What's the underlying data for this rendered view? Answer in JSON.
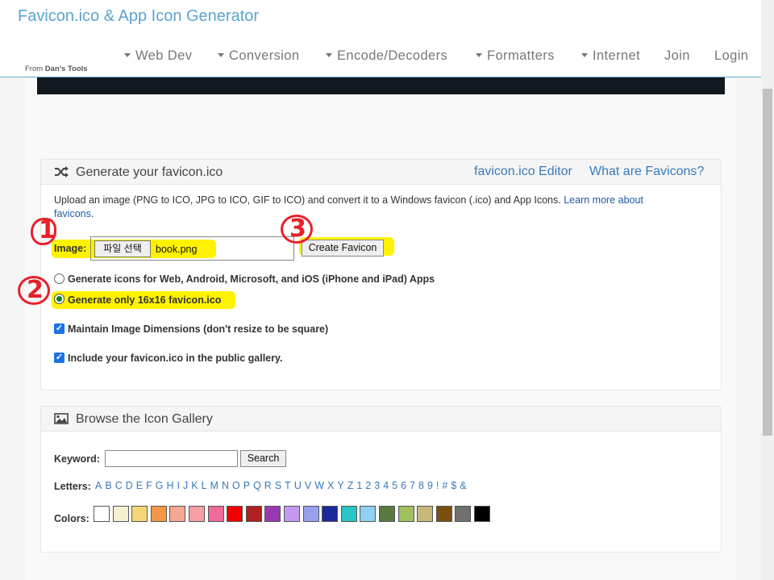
{
  "header": {
    "title": "Favicon.ico & App Icon Generator",
    "from_prefix": "From",
    "from_name": "Dan's Tools",
    "nav": [
      {
        "label": "Web Dev",
        "dropdown": true
      },
      {
        "label": "Conversion",
        "dropdown": true
      },
      {
        "label": "Encode/Decoders",
        "dropdown": true
      },
      {
        "label": "Formatters",
        "dropdown": true
      },
      {
        "label": "Internet",
        "dropdown": true
      },
      {
        "label": "Join",
        "dropdown": false
      },
      {
        "label": "Login",
        "dropdown": false
      }
    ]
  },
  "generate_panel": {
    "title": "Generate your favicon.ico",
    "icon": "shuffle-icon",
    "links": [
      "favicon.ico Editor",
      "What are Favicons?"
    ],
    "description": "Upload an image (PNG to ICO, JPG to ICO, GIF to ICO) and convert it to a Windows favicon (.ico) and App Icons.",
    "learn_more": "Learn more about",
    "learn_more_2": "favicons",
    "learn_more_end": ".",
    "image_label": "Image:",
    "file_button": "파일 선택",
    "file_name": "book.png",
    "create_button": "Create Favicon",
    "options": [
      {
        "type": "radio",
        "label": "Generate icons for Web, Android, Microsoft, and iOS (iPhone and iPad) Apps",
        "checked": false
      },
      {
        "type": "radio",
        "label": "Generate only 16x16 favicon.ico",
        "checked": true
      },
      {
        "type": "checkbox",
        "label": "Maintain Image Dimensions (don't resize to be square)",
        "checked": true
      },
      {
        "type": "checkbox",
        "label": "Include your favicon.ico in the public gallery.",
        "checked": true
      }
    ]
  },
  "annotations": {
    "step1": "1",
    "step2": "2",
    "step3": "3",
    "highlight_color": "#fff200",
    "marker_color": "#e8202a"
  },
  "gallery_panel": {
    "title": "Browse the Icon Gallery",
    "icon": "image-icon",
    "keyword_label": "Keyword:",
    "keyword_value": "",
    "search_button": "Search",
    "letters_label": "Letters:",
    "letters": [
      "A",
      "B",
      "C",
      "D",
      "E",
      "F",
      "G",
      "H",
      "I",
      "J",
      "K",
      "L",
      "M",
      "N",
      "O",
      "P",
      "Q",
      "R",
      "S",
      "T",
      "U",
      "V",
      "W",
      "X",
      "Y",
      "Z",
      "1",
      "2",
      "3",
      "4",
      "5",
      "6",
      "7",
      "8",
      "9",
      "!",
      "#",
      "$",
      "&"
    ],
    "colors_label": "Colors:",
    "colors": [
      "#ffffff",
      "#f5f0d0",
      "#f5d77a",
      "#f5974a",
      "#f5a894",
      "#f5a0a4",
      "#f06a9a",
      "#f00000",
      "#b02020",
      "#9a3ab0",
      "#c49af0",
      "#9aa0f0",
      "#1a2a9a",
      "#2ac4c4",
      "#90d0f0",
      "#5a7a40",
      "#a0c060",
      "#c8b87a",
      "#7a5010",
      "#707070",
      "#000000"
    ]
  }
}
